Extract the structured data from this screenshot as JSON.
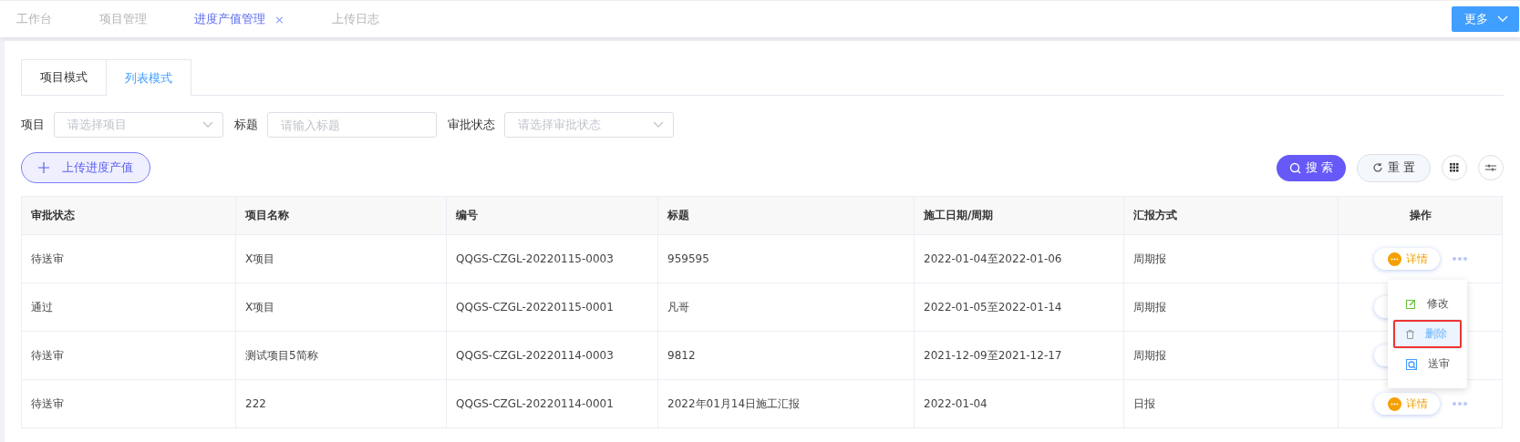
{
  "nav_tabs": [
    {
      "label": "工作台",
      "selected": false,
      "closable": false
    },
    {
      "label": "项目管理",
      "selected": false,
      "closable": false
    },
    {
      "label": "进度产值管理",
      "selected": true,
      "closable": true,
      "close": "×"
    },
    {
      "label": "上传日志",
      "selected": false,
      "closable": false
    }
  ],
  "more_button": "更多",
  "mode_tabs": [
    {
      "label": "项目模式",
      "selected": false
    },
    {
      "label": "列表模式",
      "selected": true
    }
  ],
  "filters": [
    {
      "label": "项目",
      "kind": "select",
      "placeholder": "请选择项目"
    },
    {
      "label": "标题",
      "kind": "input",
      "placeholder": "请输入标题"
    },
    {
      "label": "审批状态",
      "kind": "select",
      "placeholder": "请选择审批状态"
    }
  ],
  "upload_button": "上传进度产值",
  "search_button": "搜 索",
  "reset_button": "重 置",
  "table": {
    "columns": [
      "审批状态",
      "项目名称",
      "编号",
      "标题",
      "施工日期/周期",
      "汇报方式",
      "操作"
    ],
    "rows": [
      {
        "cells": [
          "待送审",
          "X项目",
          "QQGS-CZGL-20220115-0003",
          "959595",
          "2022-01-04至2022-01-06",
          "周期报"
        ],
        "action": "详情"
      },
      {
        "cells": [
          "通过",
          "X项目",
          "QQGS-CZGL-20220115-0001",
          "凡哥",
          "2022-01-05至2022-01-14",
          "周期报"
        ]
      },
      {
        "cells": [
          "待送审",
          "测试项目5简称",
          "QQGS-CZGL-20220114-0003",
          "9812",
          "2021-12-09至2021-12-17",
          "周期报"
        ]
      },
      {
        "cells": [
          "待送审",
          "222",
          "QQGS-CZGL-20220114-0001",
          "2022年01月14日施工汇报",
          "2022-01-04",
          "日报"
        ],
        "action": "详情"
      }
    ]
  },
  "action_menu": [
    {
      "label": "修改",
      "kind": "edit",
      "selected": false
    },
    {
      "label": "删除",
      "kind": "delete",
      "selected": true
    },
    {
      "label": "送审",
      "kind": "review",
      "selected": false
    }
  ]
}
